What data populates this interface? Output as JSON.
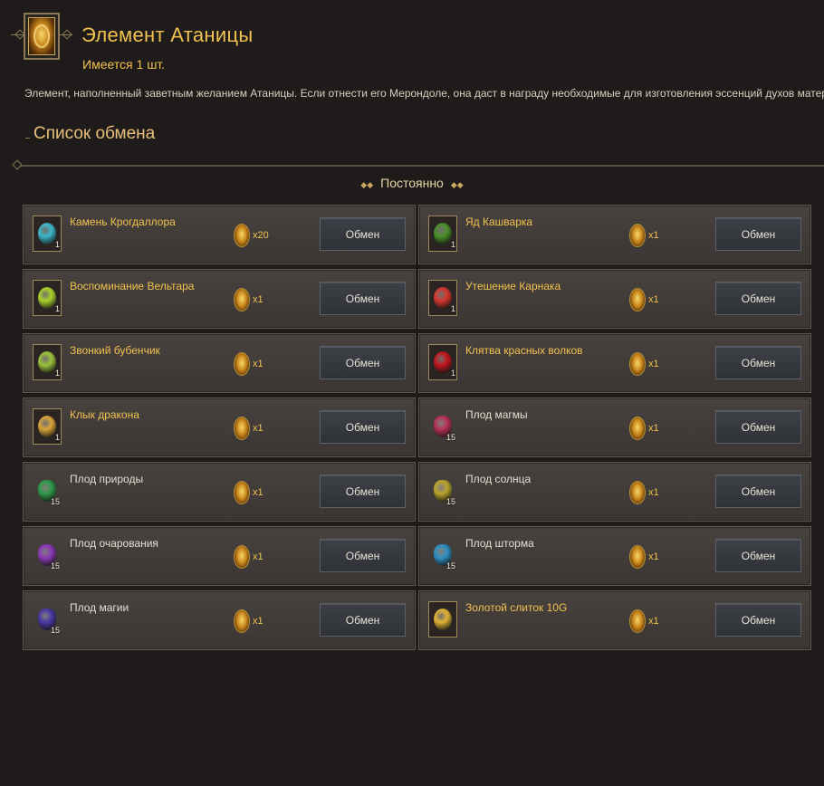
{
  "header": {
    "icon": "golden-element-icon",
    "title": "Элемент Атаницы",
    "owned": "Имеется 1 шт."
  },
  "description": "Элемент, наполненный заветным желанием Атаницы. Если отнести его Мерондоле, она даст в награду необходимые для изготовления эссенций духов материалы.",
  "exchange": {
    "section_title": "Список обмена",
    "period_label": "Постоянно",
    "cost_icon": "atanica-element-coin-icon",
    "items": [
      {
        "name": "Камень Крогдаллора",
        "qty": "1",
        "cost": "x20",
        "button": "Обмен",
        "rarity": "gold",
        "icon": "krogdallor-stone-icon",
        "color": "#3db6c9"
      },
      {
        "name": "Яд Кашварка",
        "qty": "1",
        "cost": "x1",
        "button": "Обмен",
        "rarity": "gold",
        "icon": "kashvark-poison-icon",
        "color": "#4a8f2a"
      },
      {
        "name": "Воспоминание Вельтара",
        "qty": "1",
        "cost": "x1",
        "button": "Обмен",
        "rarity": "gold",
        "icon": "veltar-memory-icon",
        "color": "#a9d22b"
      },
      {
        "name": "Утешение Карнака",
        "qty": "1",
        "cost": "x1",
        "button": "Обмен",
        "rarity": "gold",
        "icon": "karnak-solace-icon",
        "color": "#d6382f"
      },
      {
        "name": "Звонкий бубенчик",
        "qty": "1",
        "cost": "x1",
        "button": "Обмен",
        "rarity": "gold",
        "icon": "ringing-bell-icon",
        "color": "#9ac23a"
      },
      {
        "name": "Клятва красных волков",
        "qty": "1",
        "cost": "x1",
        "button": "Обмен",
        "rarity": "gold",
        "icon": "red-wolves-oath-icon",
        "color": "#c2161d"
      },
      {
        "name": "Клык дракона",
        "qty": "1",
        "cost": "x1",
        "button": "Обмен",
        "rarity": "gold",
        "icon": "dragon-fang-icon",
        "color": "#d9a43a"
      },
      {
        "name": "Плод магмы",
        "qty": "15",
        "cost": "x1",
        "button": "Обмен",
        "rarity": "white",
        "icon": "magma-fruit-icon",
        "color": "#b8325a"
      },
      {
        "name": "Плод природы",
        "qty": "15",
        "cost": "x1",
        "button": "Обмен",
        "rarity": "white",
        "icon": "nature-fruit-icon",
        "color": "#2f9a4a"
      },
      {
        "name": "Плод солнца",
        "qty": "15",
        "cost": "x1",
        "button": "Обмен",
        "rarity": "white",
        "icon": "sun-fruit-icon",
        "color": "#b9a52a"
      },
      {
        "name": "Плод очарования",
        "qty": "15",
        "cost": "x1",
        "button": "Обмен",
        "rarity": "white",
        "icon": "charm-fruit-icon",
        "color": "#8a3ab5"
      },
      {
        "name": "Плод шторма",
        "qty": "15",
        "cost": "x1",
        "button": "Обмен",
        "rarity": "white",
        "icon": "storm-fruit-icon",
        "color": "#2f8fc2"
      },
      {
        "name": "Плод магии",
        "qty": "15",
        "cost": "x1",
        "button": "Обмен",
        "rarity": "white",
        "icon": "magic-fruit-icon",
        "color": "#4a3aa5"
      },
      {
        "name": "Золотой слиток 10G",
        "qty": "",
        "cost": "x1",
        "button": "Обмен",
        "rarity": "gold",
        "icon": "gold-ingot-icon",
        "color": "#e0b437"
      }
    ]
  }
}
